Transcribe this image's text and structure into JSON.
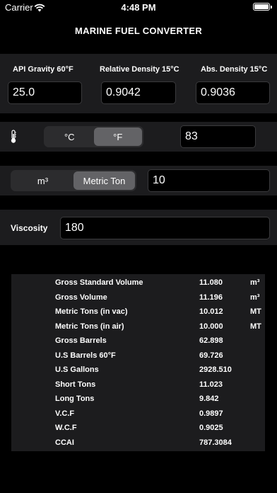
{
  "status_bar": {
    "carrier": "Carrier",
    "time": "4:48 PM"
  },
  "title": "MARINE FUEL CONVERTER",
  "density": {
    "api_label": "API Gravity 60°F",
    "api_value": "25.0",
    "rel_label": "Relative Density 15°C",
    "rel_value": "0.9042",
    "abs_label": "Abs. Density 15°C",
    "abs_value": "0.9036"
  },
  "temperature": {
    "icon": "thermometer-icon",
    "options": [
      "°C",
      "°F"
    ],
    "selected": "°F",
    "value": "83"
  },
  "quantity": {
    "options": [
      "m³",
      "Metric Ton"
    ],
    "selected": "Metric Ton",
    "value": "10"
  },
  "viscosity": {
    "label": "Viscosity",
    "value": "180"
  },
  "results": [
    {
      "name": "Gross Standard Volume",
      "value": "11.080",
      "unit": "m³"
    },
    {
      "name": "Gross Volume",
      "value": "11.196",
      "unit": "m³"
    },
    {
      "name": "Metric Tons (in vac)",
      "value": "10.012",
      "unit": "MT"
    },
    {
      "name": "Metric Tons (in air)",
      "value": "10.000",
      "unit": "MT"
    },
    {
      "name": "Gross Barrels",
      "value": "62.898",
      "unit": ""
    },
    {
      "name": "U.S Barrels 60°F",
      "value": "69.726",
      "unit": ""
    },
    {
      "name": "U.S Gallons",
      "value": "2928.510",
      "unit": ""
    },
    {
      "name": "Short Tons",
      "value": "11.023",
      "unit": ""
    },
    {
      "name": "Long Tons",
      "value": "9.842",
      "unit": ""
    },
    {
      "name": "V.C.F",
      "value": "0.9897",
      "unit": ""
    },
    {
      "name": "W.C.F",
      "value": "0.9025",
      "unit": ""
    },
    {
      "name": "CCAI",
      "value": "787.3084",
      "unit": ""
    }
  ]
}
